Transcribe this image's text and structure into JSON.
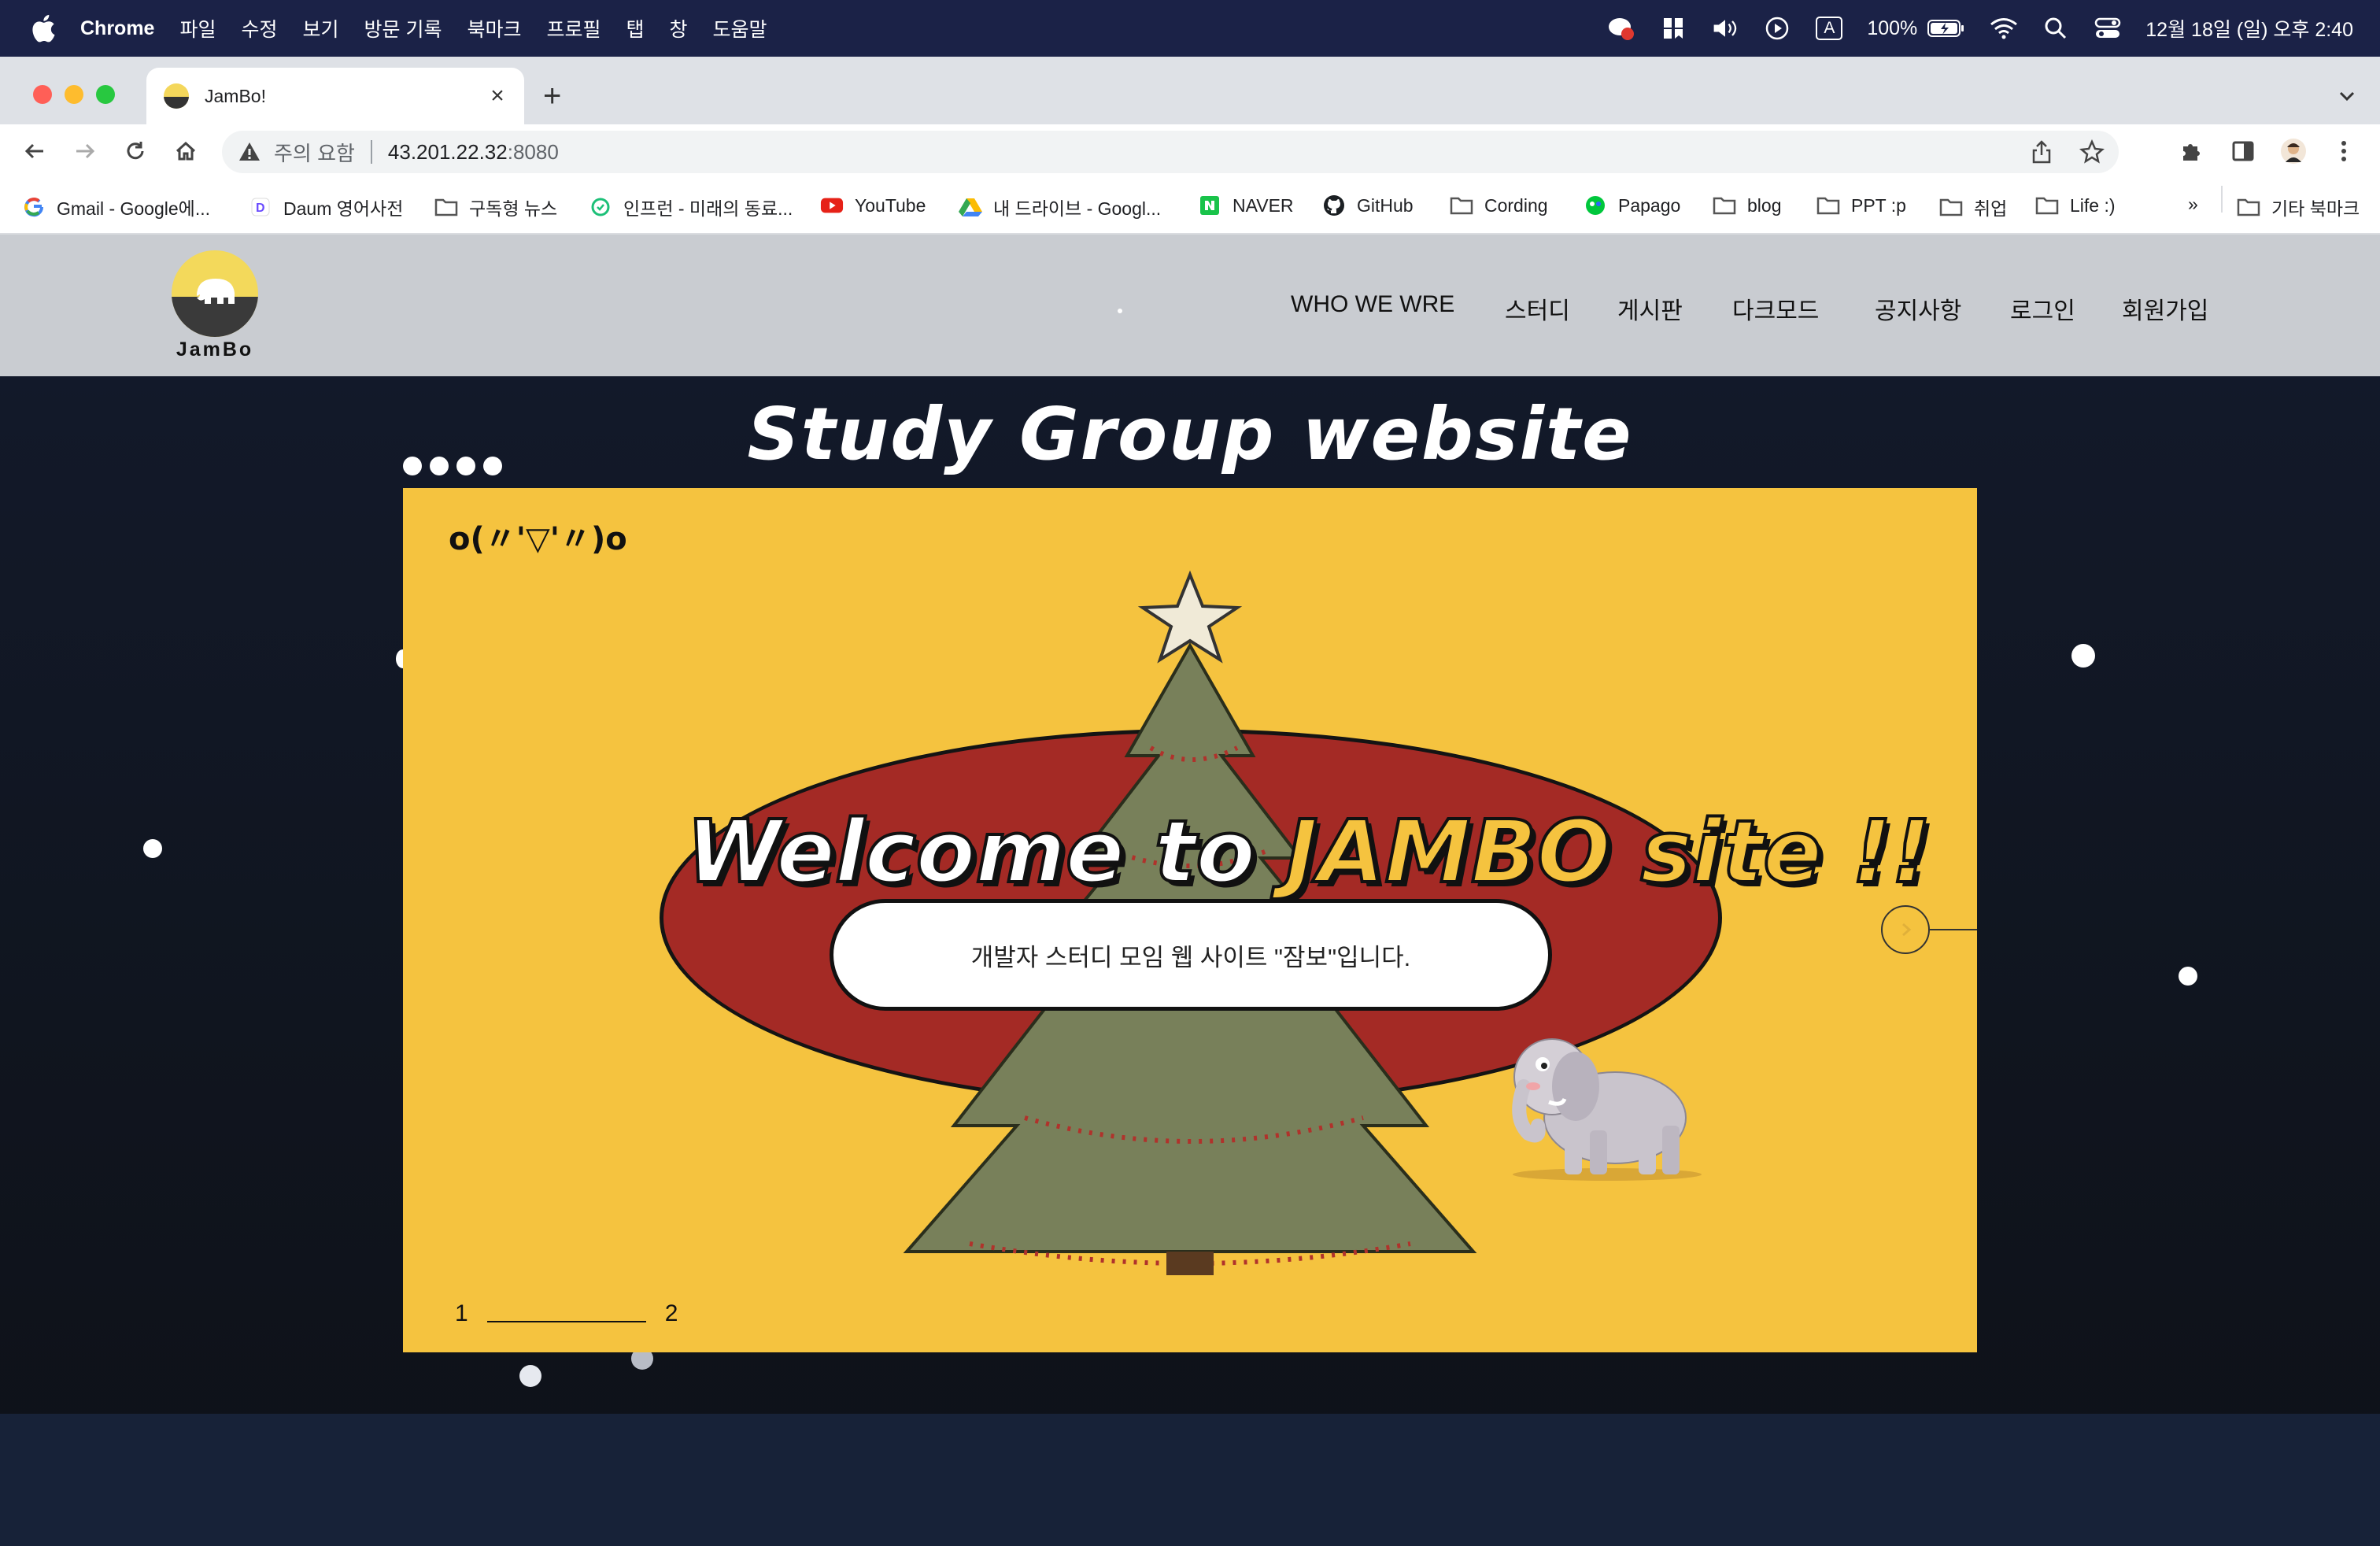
{
  "macos_menubar": {
    "app_name": "Chrome",
    "menus": [
      "파일",
      "수정",
      "보기",
      "방문 기록",
      "북마크",
      "프로필",
      "탭",
      "창",
      "도움말"
    ],
    "input_indicator": "A",
    "battery": "100%",
    "datetime": "12월 18일 (일) 오후 2:40"
  },
  "browser": {
    "tab": {
      "title": "JamBo!"
    },
    "omnibox": {
      "security_text": "주의 요함",
      "host": "43.201.22.32",
      "port": ":8080"
    },
    "bookmarks": [
      {
        "label": "Gmail - Google에...",
        "icon": "google-icon"
      },
      {
        "label": "Daum 영어사전",
        "icon": "daum-icon"
      },
      {
        "label": "구독형 뉴스",
        "icon": "folder-icon"
      },
      {
        "label": "인프런 - 미래의 동료...",
        "icon": "inflearn-icon"
      },
      {
        "label": "YouTube",
        "icon": "youtube-icon"
      },
      {
        "label": "내 드라이브 - Googl...",
        "icon": "drive-icon"
      },
      {
        "label": "NAVER",
        "icon": "naver-icon"
      },
      {
        "label": "GitHub",
        "icon": "github-icon"
      },
      {
        "label": "Cording",
        "icon": "folder-icon"
      },
      {
        "label": "Papago",
        "icon": "papago-icon"
      },
      {
        "label": "blog",
        "icon": "folder-icon"
      },
      {
        "label": "PPT :p",
        "icon": "folder-icon"
      },
      {
        "label": "취업",
        "icon": "folder-icon"
      },
      {
        "label": "Life :)",
        "icon": "folder-icon"
      }
    ],
    "overflow": "»",
    "other_bookmarks": "기타 북마크"
  },
  "site": {
    "logo_text": "JamBo",
    "nav": [
      "WHO WE WRE",
      "스터디",
      "게시판",
      "다크모드",
      "공지사항",
      "로그인",
      "회원가입"
    ],
    "hero_title": "Study Group website",
    "slide": {
      "emoticon": "o(〃'▽'〃)o",
      "welcome_prefix": "Welcome to",
      "welcome_highlight": "JAMBO site !!",
      "subtitle": "개발자 스터디 모임  웹 사이트 \"잠보\"입니다.",
      "pager_start": "1",
      "pager_end": "2"
    },
    "colors": {
      "slide_bg": "#f5c33f",
      "oval": "#a42a25",
      "nav_bg": "#c9ccd1",
      "page_bg": "#131a2c"
    }
  }
}
